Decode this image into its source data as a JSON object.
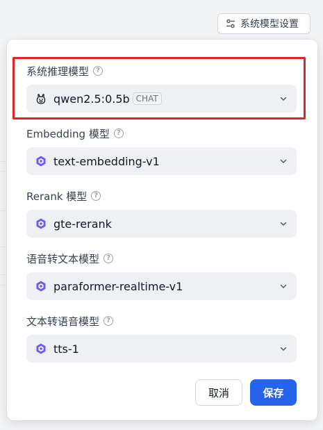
{
  "header": {
    "settings_button_label": "系统模型设置"
  },
  "fields": [
    {
      "label": "系统推理模型",
      "value": "qwen2.5:0.5b",
      "chip": "CHAT",
      "icon": "llama-icon"
    },
    {
      "label": "Embedding 模型",
      "value": "text-embedding-v1",
      "icon": "qwen-logo-icon"
    },
    {
      "label": "Rerank 模型",
      "value": "gte-rerank",
      "icon": "qwen-logo-icon"
    },
    {
      "label": "语音转文本模型",
      "value": "paraformer-realtime-v1",
      "icon": "qwen-logo-icon"
    },
    {
      "label": "文本转语音模型",
      "value": "tts-1",
      "icon": "qwen-logo-icon"
    }
  ],
  "actions": {
    "cancel_label": "取消",
    "save_label": "保存"
  },
  "colors": {
    "primary": "#2563eb",
    "highlight": "#e02424",
    "select_bg": "#eff0f4",
    "qwen_logo": "#6d5cf6"
  }
}
